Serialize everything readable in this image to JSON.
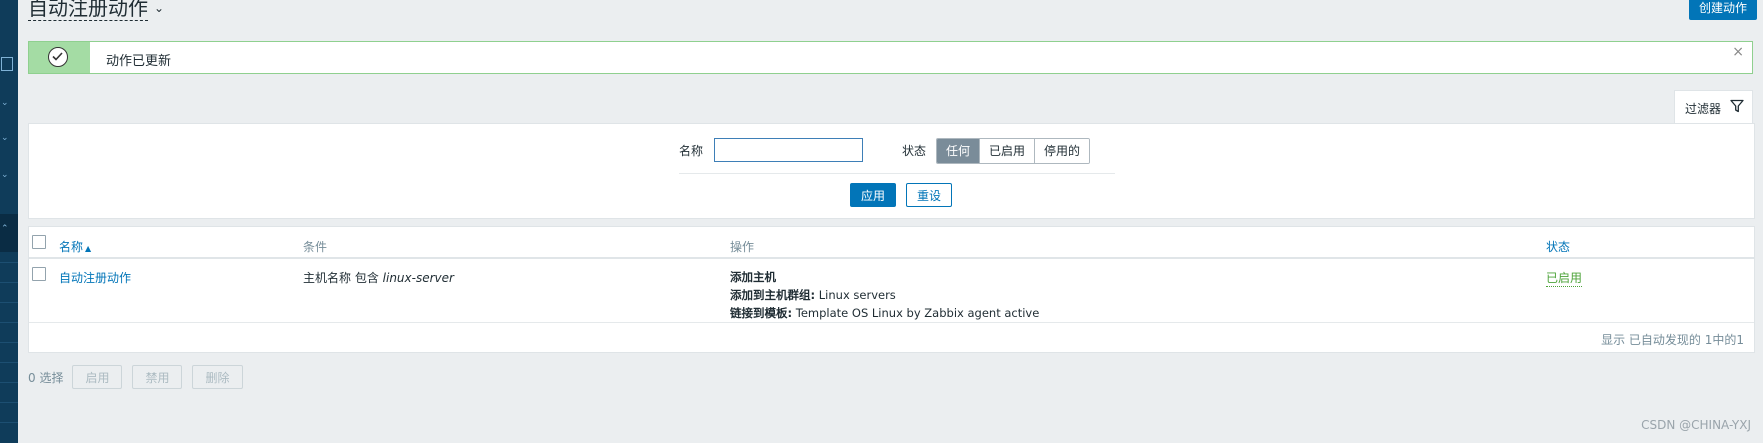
{
  "page": {
    "title": "自动注册动作",
    "create_button": "创建动作"
  },
  "message": {
    "text": "动作已更新",
    "close": "×"
  },
  "filter": {
    "tab_label": "过滤器",
    "name_label": "名称",
    "name_value": "",
    "status_label": "状态",
    "status_options": [
      "任何",
      "已启用",
      "停用的"
    ],
    "status_selected": "任何",
    "apply_button": "应用",
    "reset_button": "重设"
  },
  "table": {
    "headers": {
      "name": "名称",
      "conditions": "条件",
      "operations": "操作",
      "status": "状态"
    },
    "sort_indicator": "▲",
    "rows": [
      {
        "name": "自动注册动作",
        "condition_text": "主机名称 包含",
        "condition_value": "linux-server",
        "operations": [
          {
            "label": "添加主机",
            "value": ""
          },
          {
            "label": "添加到主机群组:",
            "value": "Linux servers"
          },
          {
            "label": "链接到模板:",
            "value": "Template OS Linux by Zabbix agent active"
          }
        ],
        "status": "已启用"
      }
    ],
    "paging_text": "显示 已自动发现的 1中的1"
  },
  "actions": {
    "selected_count": "0 选择",
    "enable_button": "启用",
    "disable_button": "禁用",
    "delete_button": "删除"
  },
  "watermark": "CSDN @CHINA-YXJ",
  "colors": {
    "accent": "#0275b8",
    "success_bg": "#a4dca4",
    "enabled_status": "#4da33a",
    "sidebar": "#0f3c5a"
  }
}
